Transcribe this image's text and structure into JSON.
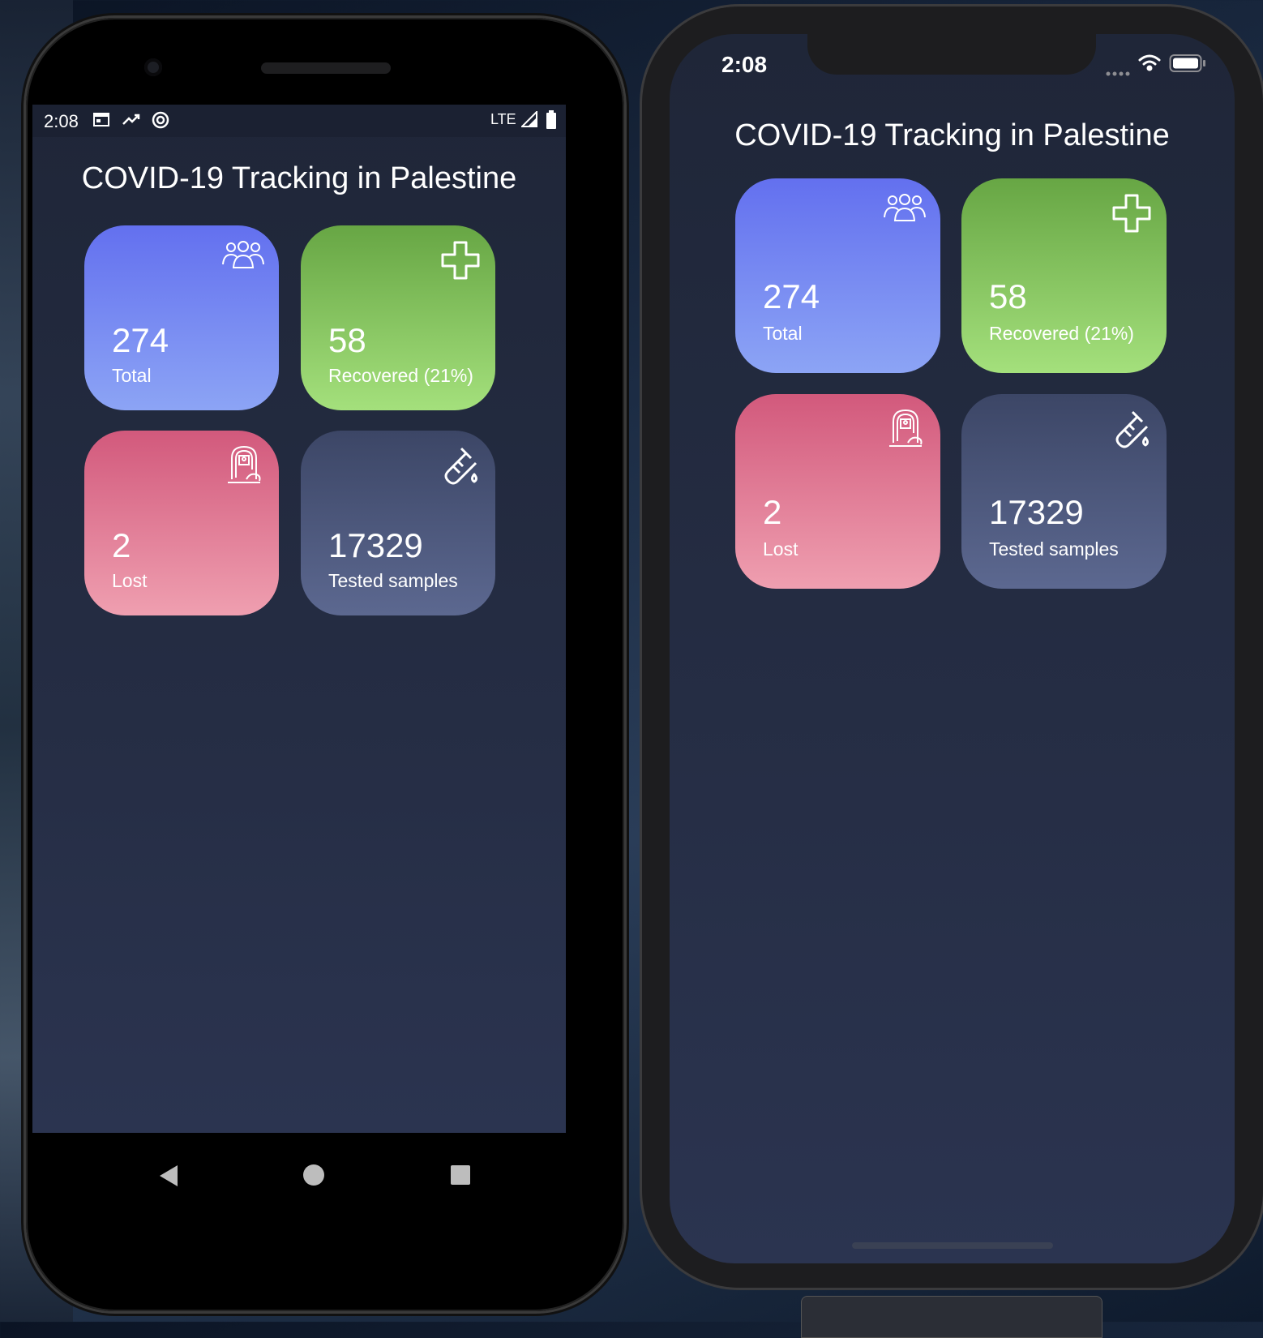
{
  "app": {
    "title": "COVID-19 Tracking in Palestine"
  },
  "android": {
    "status_time": "2:08",
    "network": "LTE"
  },
  "ios": {
    "status_time": "2:08"
  },
  "cards": [
    {
      "id": "total",
      "value": "274",
      "label": "Total",
      "icon": "people-group-icon",
      "color": "#6f7ff2"
    },
    {
      "id": "recovered",
      "value": "58",
      "label": "Recovered  (21%)",
      "icon": "plus-cross-icon",
      "color": "#84c45f"
    },
    {
      "id": "lost",
      "value": "2",
      "label": "Lost",
      "icon": "tombstone-icon",
      "color": "#e07790"
    },
    {
      "id": "tested",
      "value": "17329",
      "label": "Tested samples",
      "icon": "test-tube-icon",
      "color": "#4b5679"
    }
  ]
}
